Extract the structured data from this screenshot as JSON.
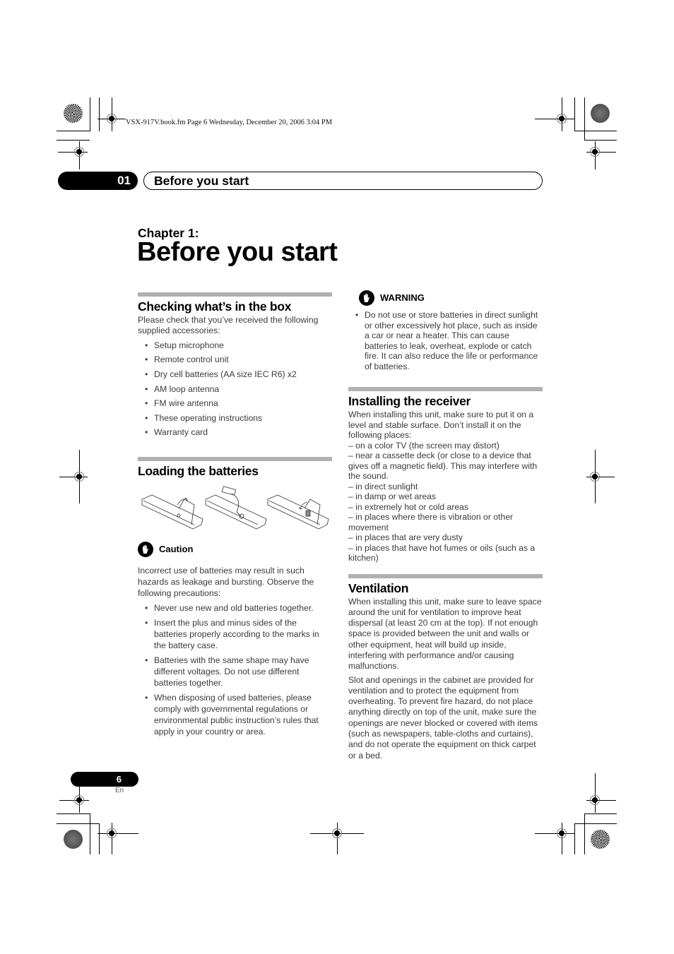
{
  "print_header": "VSX-917V.book.fm  Page 6  Wednesday, December 20, 2006  3:04 PM",
  "chapter_tab": {
    "number": "01",
    "title": "Before you start"
  },
  "chapter": {
    "label": "Chapter 1:",
    "title": "Before you start"
  },
  "left_column": {
    "checking": {
      "heading": "Checking what’s in the box",
      "intro": "Please check that you’ve received the following supplied accessories:",
      "items": [
        "Setup microphone",
        "Remote control unit",
        "Dry cell batteries (AA size IEC R6) x2",
        "AM loop antenna",
        "FM wire antenna",
        "These operating instructions",
        "Warranty card"
      ]
    },
    "loading": {
      "heading": "Loading the batteries",
      "illustration": "remote-control-battery-loading-steps"
    },
    "caution": {
      "label": "Caution",
      "icon": "hand-stop-icon",
      "intro": "Incorrect use of batteries may result in such hazards as leakage and bursting. Observe the following precautions:",
      "items": [
        "Never use new and old batteries together.",
        "Insert the plus and minus sides of the batteries properly according to the marks in the battery case.",
        "Batteries with the same shape may have different voltages. Do not use different batteries together.",
        "When disposing of used batteries, please comply with governmental regulations or environmental public instruction’s rules that apply in your country or area."
      ]
    }
  },
  "right_column": {
    "warning": {
      "label": "WARNING",
      "icon": "hand-stop-icon",
      "items": [
        "Do not use or store batteries in direct sunlight or other excessively hot place, such as inside a car or near a heater. This can cause batteries to leak, overheat, explode or catch fire. It can also reduce the life or performance of batteries."
      ]
    },
    "installing": {
      "heading": "Installing the receiver",
      "intro": "When installing this unit, make sure to put it on a level and stable surface. Don’t install it on the following places:",
      "places": [
        "– on a color TV (the screen may distort)",
        "– near a cassette deck (or close to a device that gives off a magnetic field). This may interfere with the sound.",
        "– in direct sunlight",
        "– in damp or wet areas",
        "– in extremely hot or cold areas",
        "– in places where there is vibration or other movement",
        "– in places that are very dusty",
        "– in places that have hot fumes or oils (such as a kitchen)"
      ]
    },
    "ventilation": {
      "heading": "Ventilation",
      "paragraphs": [
        "When installing this unit, make sure to leave space around the unit for ventilation to improve heat dispersal (at least 20 cm at the top). If not enough space is provided between the unit and walls or other equipment, heat will build up inside, interfering with performance and/or causing malfunctions.",
        "Slot and openings in the cabinet are provided for ventilation and to protect the equipment from overheating. To prevent fire hazard, do not place anything directly on top of the unit, make sure the openings are never blocked or covered with items (such as newspapers, table-cloths and curtains), and do not operate the equipment on thick carpet or a bed."
      ]
    }
  },
  "footer": {
    "page_number": "6",
    "language": "En"
  }
}
